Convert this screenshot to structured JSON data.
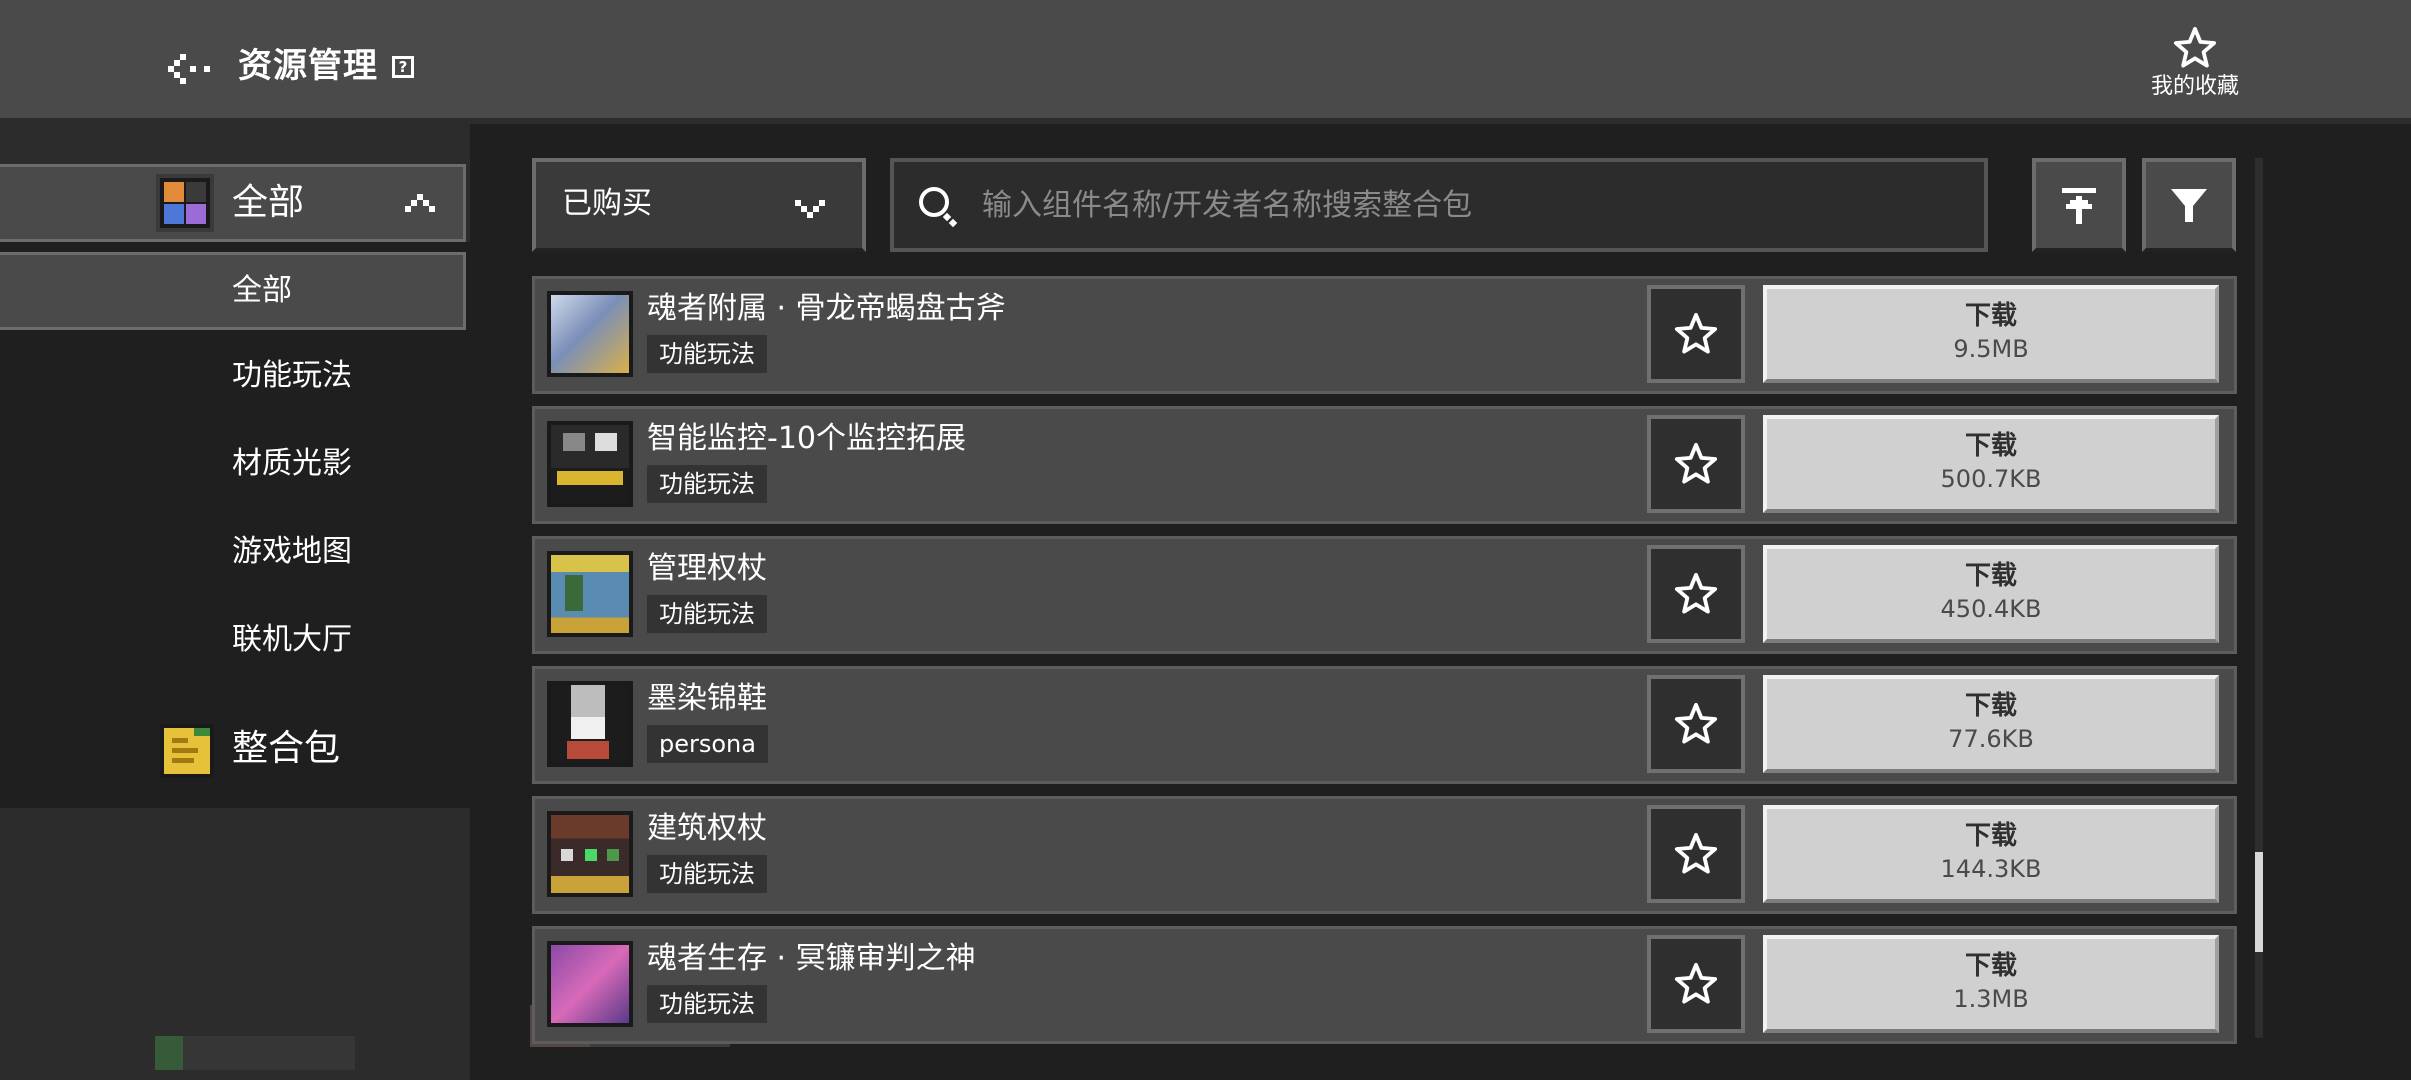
{
  "header": {
    "title": "资源管理",
    "help_glyph": "?",
    "favorites_label": "我的收藏"
  },
  "sidebar": {
    "category_label": "全部",
    "sub_items": [
      {
        "label": "全部",
        "active": true
      },
      {
        "label": "功能玩法",
        "active": false
      },
      {
        "label": "材质光影",
        "active": false
      },
      {
        "label": "游戏地图",
        "active": false
      },
      {
        "label": "联机大厅",
        "active": false
      }
    ],
    "pack_label": "整合包"
  },
  "toolbar": {
    "filter_selected": "已购买",
    "search_placeholder": "输入组件名称/开发者名称搜索整合包"
  },
  "items": [
    {
      "title": "魂者附属 · 骨龙帝蝎盘古斧",
      "tag": "功能玩法",
      "download_label": "下载",
      "size": "9.5MB"
    },
    {
      "title": "智能监控-10个监控拓展",
      "tag": "功能玩法",
      "download_label": "下载",
      "size": "500.7KB"
    },
    {
      "title": "管理权杖",
      "tag": "功能玩法",
      "download_label": "下载",
      "size": "450.4KB"
    },
    {
      "title": "墨染锦鞋",
      "tag": "persona",
      "download_label": "下载",
      "size": "77.6KB"
    },
    {
      "title": "建筑权杖",
      "tag": "功能玩法",
      "download_label": "下载",
      "size": "144.3KB"
    },
    {
      "title": "魂者生存 · 冥镰审判之神",
      "tag": "功能玩法",
      "download_label": "下载",
      "size": "1.3MB"
    }
  ],
  "colors": {
    "topbar": "#4a4a4b",
    "background": "#1f1f20",
    "row": "#4a4a4b",
    "download_button": "#d0d0d0",
    "pack_icon": "#e6c13a"
  }
}
